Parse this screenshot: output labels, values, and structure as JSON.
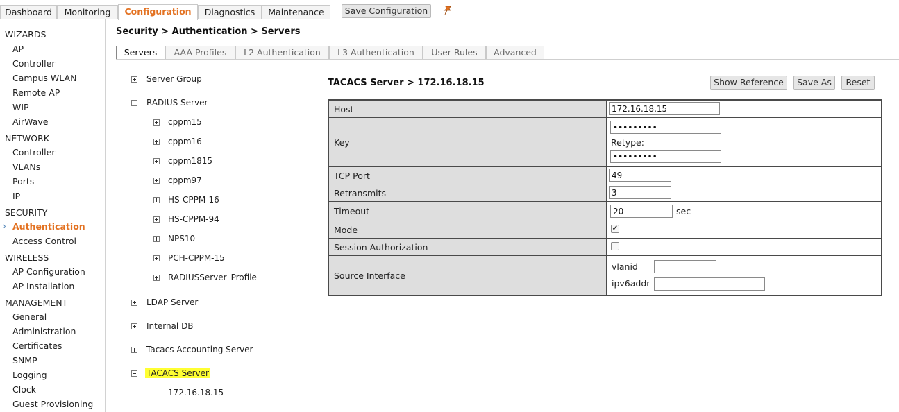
{
  "top_tabs": [
    "Dashboard",
    "Monitoring",
    "Configuration",
    "Diagnostics",
    "Maintenance"
  ],
  "active_top_tab": "Configuration",
  "save_configuration_label": "Save Configuration",
  "sidebar": {
    "sections": [
      {
        "title": "WIZARDS",
        "items": [
          "AP",
          "Controller",
          "Campus WLAN",
          "Remote AP",
          "WIP",
          "AirWave"
        ]
      },
      {
        "title": "NETWORK",
        "items": [
          "Controller",
          "VLANs",
          "Ports",
          "IP"
        ]
      },
      {
        "title": "SECURITY",
        "items": [
          "Authentication",
          "Access Control"
        ]
      },
      {
        "title": "WIRELESS",
        "items": [
          "AP Configuration",
          "AP Installation"
        ]
      },
      {
        "title": "MANAGEMENT",
        "items": [
          "General",
          "Administration",
          "Certificates",
          "SNMP",
          "Logging",
          "Clock",
          "Guest Provisioning"
        ]
      }
    ],
    "active_item": "Authentication",
    "active_marker": "›"
  },
  "breadcrumb": "Security > Authentication > Servers",
  "sub_tabs": [
    "Servers",
    "AAA Profiles",
    "L2 Authentication",
    "L3 Authentication",
    "User Rules",
    "Advanced"
  ],
  "active_sub_tab": "Servers",
  "tree": {
    "server_group": "Server Group",
    "radius_server": "RADIUS Server",
    "radius_children": [
      "cppm15",
      "cppm16",
      "cppm1815",
      "cppm97",
      "HS-CPPM-16",
      "HS-CPPM-94",
      "NPS10",
      "PCH-CPPM-15",
      "RADIUSServer_Profile"
    ],
    "ldap_server": "LDAP Server",
    "internal_db": "Internal DB",
    "tacacs_accounting": "Tacacs Accounting Server",
    "tacacs_server": "TACACS Server",
    "tacacs_children": [
      "172.16.18.15"
    ]
  },
  "panel": {
    "title": "TACACS Server > 172.16.18.15",
    "buttons": {
      "show_reference": "Show Reference",
      "save_as": "Save As",
      "reset": "Reset"
    },
    "fields": {
      "host": {
        "label": "Host",
        "value": "172.16.18.15"
      },
      "key": {
        "label": "Key",
        "value": "•••••••••",
        "retype_label": "Retype:",
        "retype_value": "•••••••••"
      },
      "tcp_port": {
        "label": "TCP Port",
        "value": "49"
      },
      "retransmits": {
        "label": "Retransmits",
        "value": "3"
      },
      "timeout": {
        "label": "Timeout",
        "value": "20",
        "unit": "sec"
      },
      "mode": {
        "label": "Mode",
        "checked": true
      },
      "session_authorization": {
        "label": "Session Authorization",
        "checked": false
      },
      "source_interface": {
        "label": "Source Interface",
        "vlanid_label": "vlanid",
        "vlanid_value": "",
        "ipv6addr_label": "ipv6addr",
        "ipv6addr_value": ""
      }
    }
  },
  "colors": {
    "accent": "#e37222",
    "highlight": "#ffff33",
    "label_bg": "#dedede",
    "border": "#4a4a4a"
  },
  "icons": {
    "pin": "pin-icon",
    "expand": "plus-box-icon",
    "collapse": "minus-box-icon"
  }
}
